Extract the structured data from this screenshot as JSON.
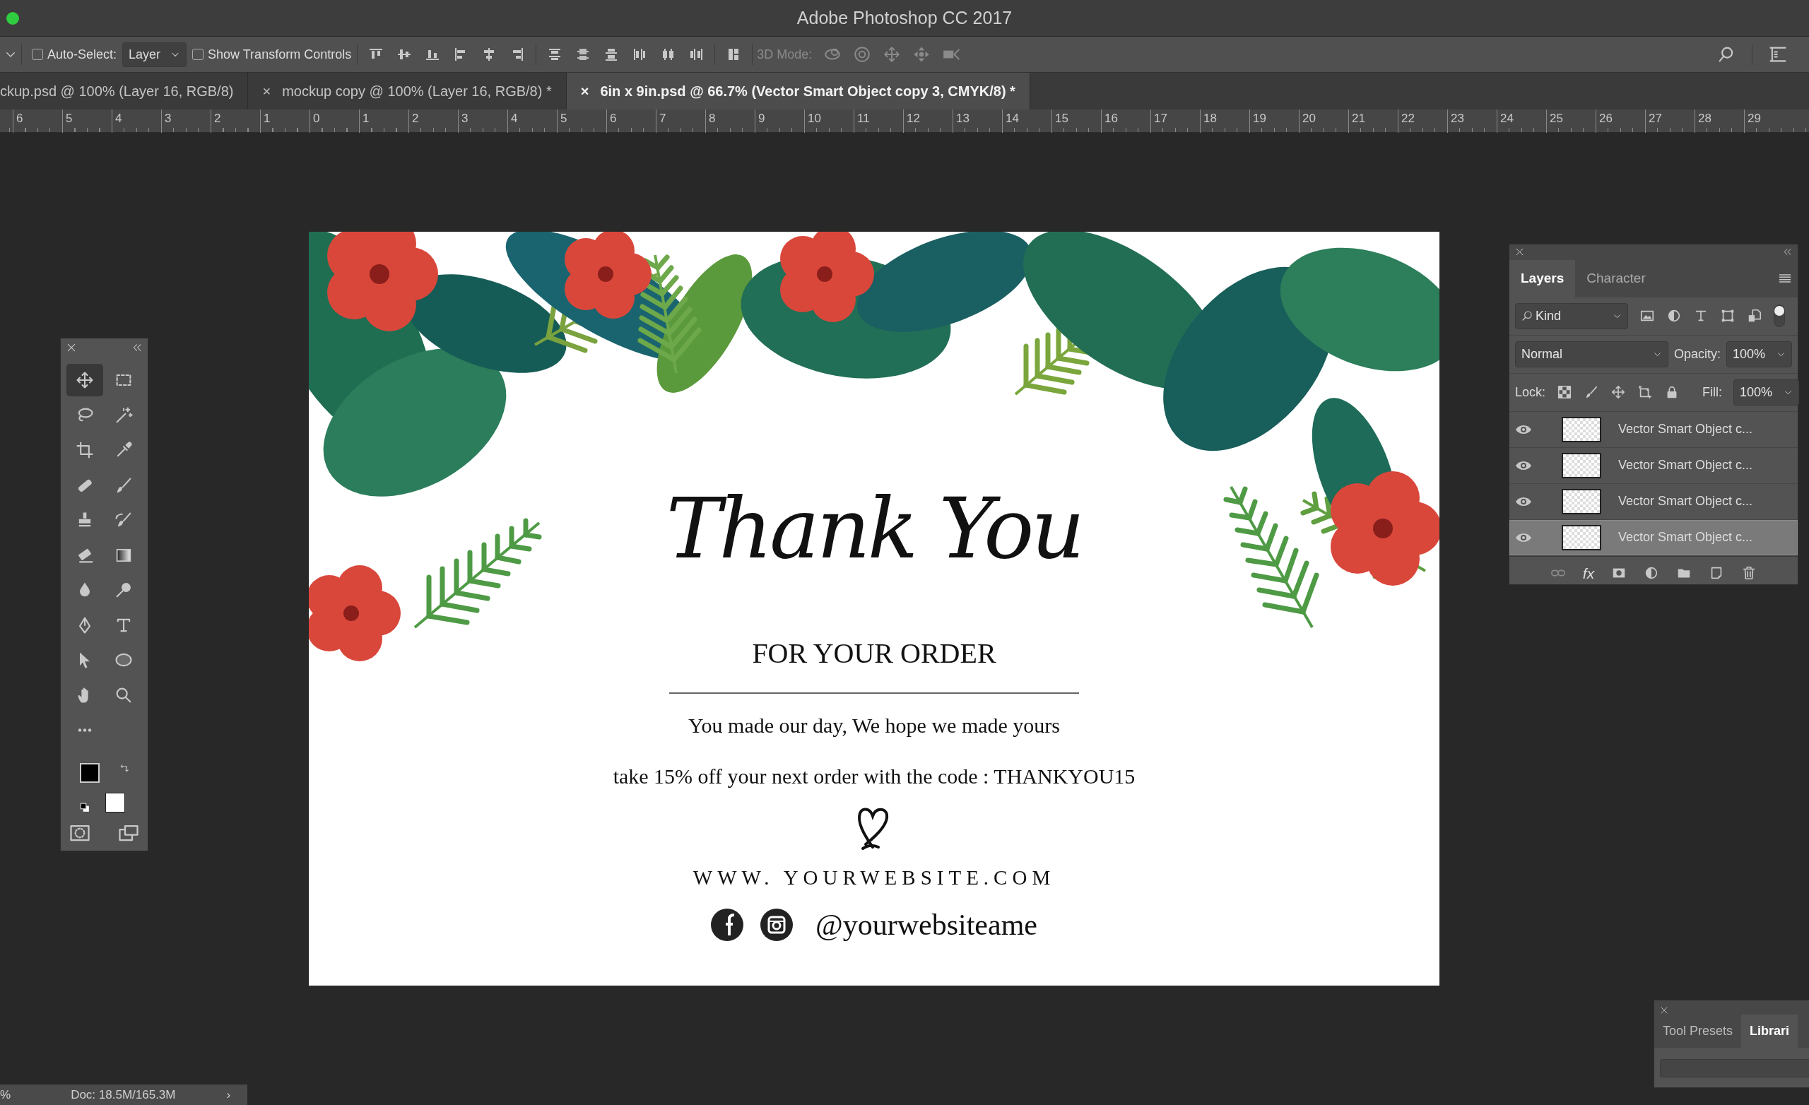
{
  "window": {
    "title": "Adobe Photoshop CC 2017"
  },
  "options_bar": {
    "auto_select": {
      "label": "Auto-Select:",
      "checked": false
    },
    "auto_select_target": "Layer",
    "show_transform_controls": {
      "label": "Show Transform Controls",
      "checked": false
    },
    "mode_3d_label": "3D Mode:"
  },
  "document_tabs": [
    {
      "title": "ckup.psd @ 100% (Layer 16, RGB/8)",
      "selected": false
    },
    {
      "title": "mockup copy @ 100% (Layer 16, RGB/8) *",
      "close": "×",
      "selected": false
    },
    {
      "title": "6in x 9in.psd @ 66.7% (Vector Smart Object copy 3, CMYK/8) *",
      "close": "×",
      "selected": true
    }
  ],
  "ruler": [
    "6",
    "5",
    "4",
    "3",
    "2",
    "1",
    "0",
    "1",
    "2",
    "3",
    "4",
    "5",
    "6",
    "7",
    "8",
    "9",
    "10",
    "11",
    "12",
    "13",
    "14",
    "15",
    "16",
    "17",
    "18",
    "19",
    "20",
    "21",
    "22",
    "23",
    "24",
    "25",
    "26",
    "27",
    "28",
    "29"
  ],
  "document": {
    "script_title": "Thank You",
    "subtitle": "FOR YOUR ORDER",
    "message": "You made our day, We hope we made yours",
    "offer": "take 15% off your next order with the code : THANKYOU15",
    "website": "WWW. YOURWEBSITE.COM",
    "handle": "@yourwebsiteame"
  },
  "tools": [
    {
      "kind": "move",
      "selected": true
    },
    {
      "kind": "marquee",
      "selected": false
    },
    {
      "kind": "lasso",
      "selected": false
    },
    {
      "kind": "wand",
      "selected": false
    },
    {
      "kind": "crop",
      "selected": false
    },
    {
      "kind": "eyedropper",
      "selected": false
    },
    {
      "kind": "bandage",
      "selected": false
    },
    {
      "kind": "brush",
      "selected": false
    },
    {
      "kind": "stamp",
      "selected": false
    },
    {
      "kind": "history-brush",
      "selected": false
    },
    {
      "kind": "eraser",
      "selected": false
    },
    {
      "kind": "gradient",
      "selected": false
    },
    {
      "kind": "drop",
      "selected": false
    },
    {
      "kind": "dodge",
      "selected": false
    },
    {
      "kind": "pen",
      "selected": false
    },
    {
      "kind": "type",
      "selected": false
    },
    {
      "kind": "arrow",
      "selected": false
    },
    {
      "kind": "ellipse",
      "selected": false
    },
    {
      "kind": "hand",
      "selected": false
    },
    {
      "kind": "zoom",
      "selected": false
    },
    {
      "kind": "more",
      "selected": false
    }
  ],
  "layers_panel": {
    "tabs": [
      {
        "label": "Layers",
        "selected": true
      },
      {
        "label": "Character",
        "selected": false
      }
    ],
    "filter": "Kind",
    "blend_mode": "Normal",
    "opacity_label": "Opacity:",
    "opacity": "100%",
    "lock_label": "Lock:",
    "fill_label": "Fill:",
    "fill": "100%",
    "fx_label": "fx",
    "layers": [
      {
        "name": "Vector Smart Object c...",
        "visible": true,
        "selected": false
      },
      {
        "name": "Vector Smart Object c...",
        "visible": true,
        "selected": false
      },
      {
        "name": "Vector Smart Object c...",
        "visible": true,
        "selected": false
      },
      {
        "name": "Vector Smart Object c...",
        "visible": true,
        "selected": true
      }
    ]
  },
  "bottom_panel": {
    "tabs": [
      {
        "label": "Tool Presets",
        "selected": false
      },
      {
        "label": "Librari",
        "selected": true
      }
    ]
  },
  "status_bar": {
    "zoom": "%",
    "doc": "Doc: 18.5M/165.3M",
    "arrow": "›"
  }
}
